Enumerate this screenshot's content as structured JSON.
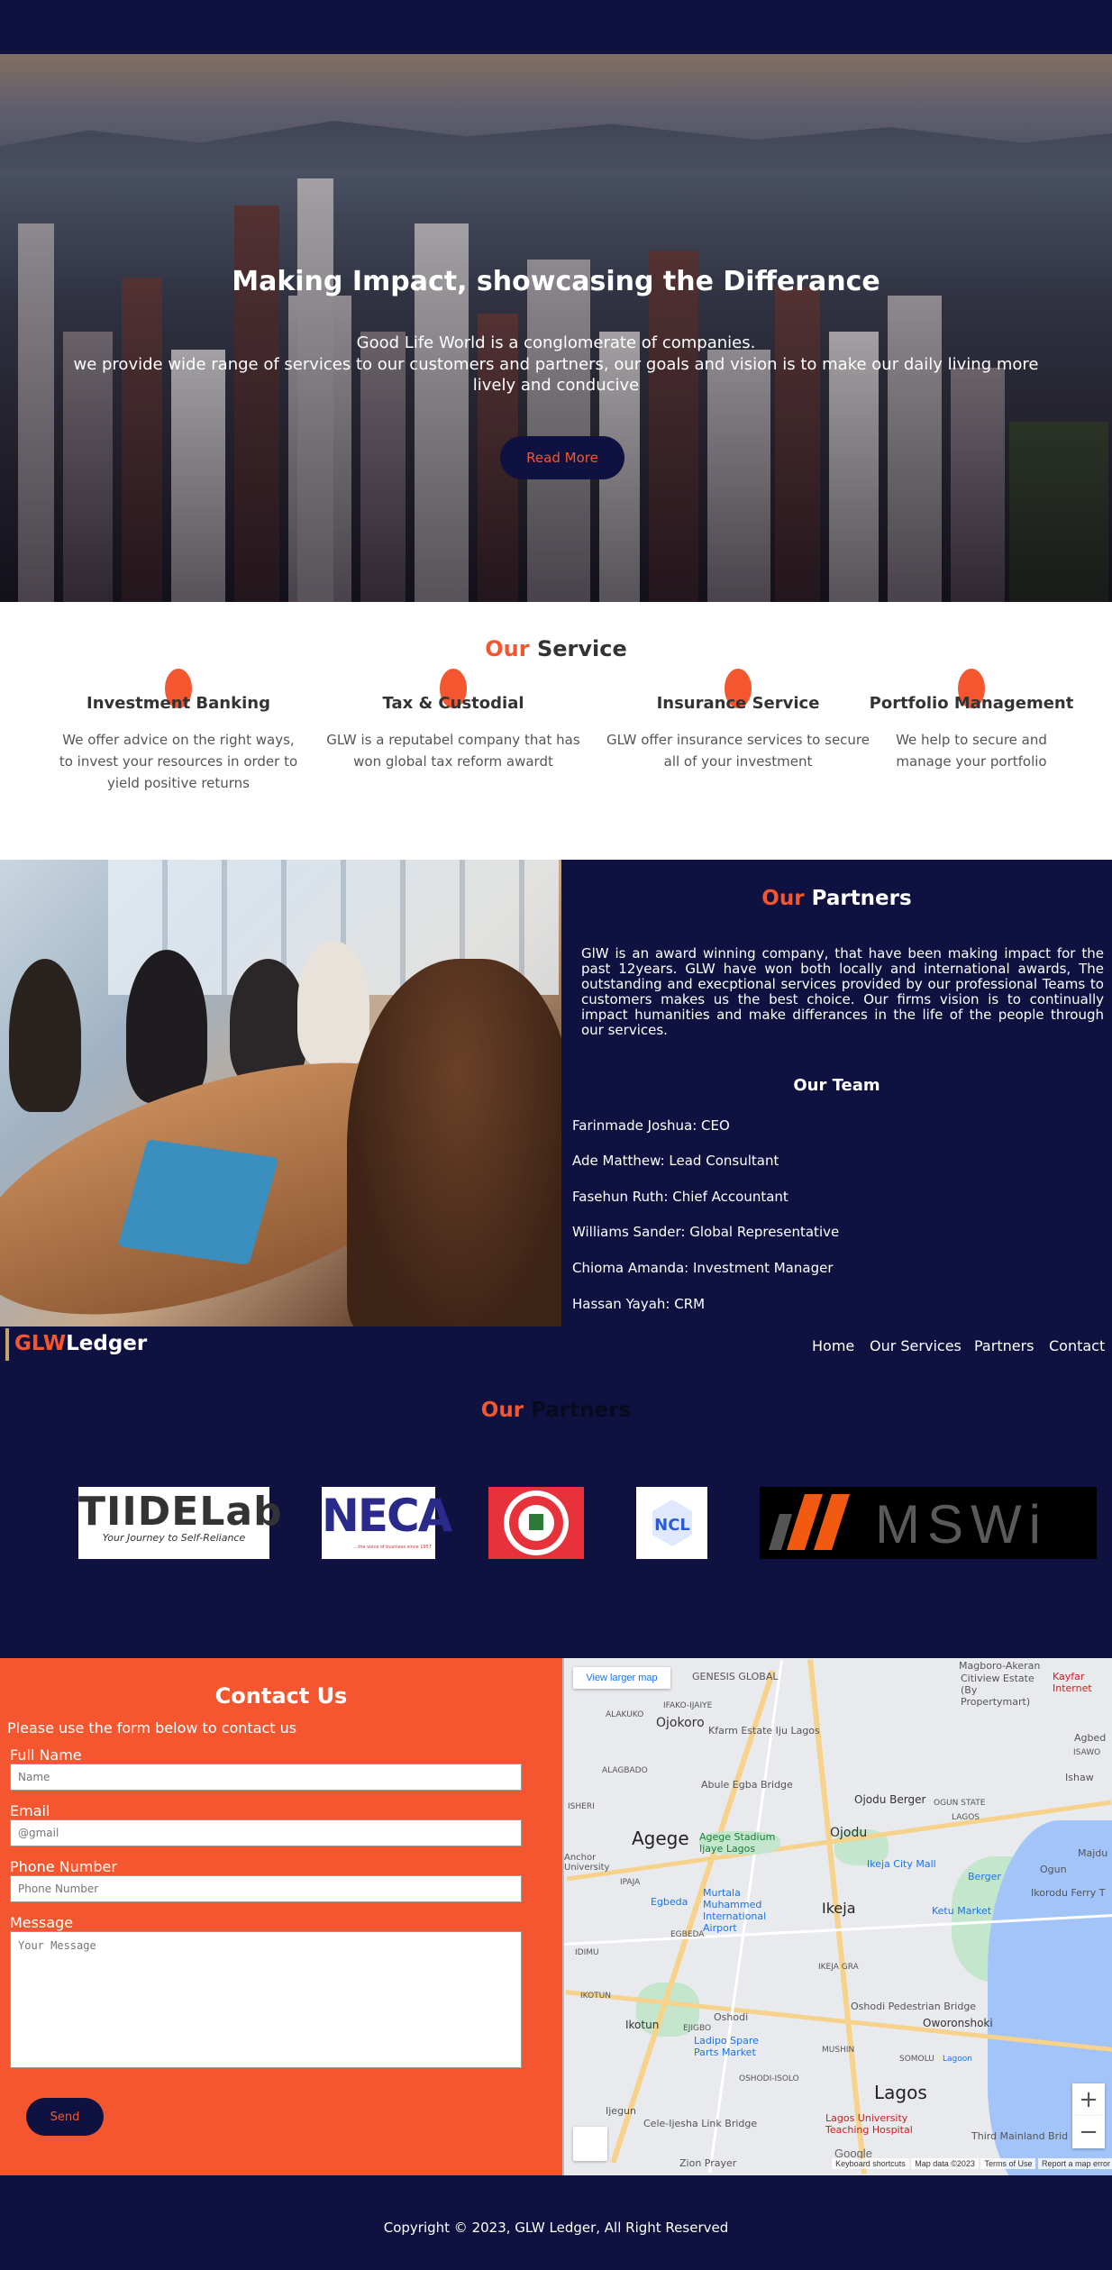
{
  "hero": {
    "title": "Making Impact, showcasing the Differance",
    "line1": "Good Life World is a conglomerate of companies.",
    "line2": "we provide wide range of services to our customers and partners, our goals and vision is to make our daily living more lively and conducive",
    "button": "Read More"
  },
  "services": {
    "title_accent": "Our",
    "title_rest": " Service",
    "items": [
      {
        "title": "Investment Banking",
        "text": "We offer advice on the right ways, to invest your resources in order to yield positive returns"
      },
      {
        "title": "Tax & Custodial",
        "text": "GLW is a reputabel company that has won global tax reform awardt"
      },
      {
        "title": "Insurance Service",
        "text": "GLW offer insurance services to secure all of your investment"
      },
      {
        "title": "Portfolio Management",
        "text": "We help to secure and manage your portfolio"
      }
    ]
  },
  "about": {
    "title_accent": "Our",
    "title_rest": " Partners",
    "text": "GlW is an award winning company, that have been making impact for the past 12years. GLW have won both locally and international awards, The outstanding and execptional services provided by our professional Teams to customers makes us the best choice. Our firms vision is to continually impact humanities and make differances in the life of the people through our services.",
    "team_title": "Our Team",
    "team": [
      "Farinmade Joshua: CEO",
      "Ade Matthew: Lead Consultant",
      "Fasehun Ruth: Chief Accountant",
      "Williams Sander: Global Representative",
      "Chioma Amanda: Investment Manager",
      "Hassan Yayah: CRM"
    ]
  },
  "nav": {
    "logo_accent": "GLW",
    "logo_rest": "Ledger",
    "links": [
      "Home",
      "Our Services",
      "Partners",
      "Contact"
    ]
  },
  "partners": {
    "title_accent": "Our",
    "title_rest": " Partners",
    "logos": [
      {
        "name": "TIIDELab",
        "tagline": "Your Journey to Self-Reliance"
      },
      {
        "name": "NECA",
        "tagline": "...the voice of business since 1957"
      },
      {
        "name": "Industrial Training Fund"
      },
      {
        "name": "NCL"
      },
      {
        "name": "MSWi"
      }
    ]
  },
  "contact": {
    "title": "Contact Us",
    "intro": "Please use the form below to contact us",
    "fields": [
      {
        "label": "Full Name",
        "placeholder": "Name"
      },
      {
        "label": "Email",
        "placeholder": "@gmail"
      },
      {
        "label": "Phone Number",
        "placeholder": "Phone Number"
      },
      {
        "label": "Message",
        "placeholder": "Your Message"
      }
    ],
    "send": "Send"
  },
  "map": {
    "view_larger": "View larger map",
    "labels": {
      "genesis": "GENESIS GLOBAL",
      "magboro": "Magboro-Akeran",
      "citiview": "Citiview Estate (By Propertymart)",
      "kayfar": "Kayfar Internet",
      "alakuko": "ALAKUKO",
      "ojokoro": "Ojokoro",
      "ifako": "IFAKO-IJAIYE",
      "kfarm": "Kfarm Estate Iju Lagos",
      "agbede": "Agbed",
      "isawo": "ISAWO",
      "alagbado": "ALAGBADO",
      "abule": "Abule Egba Bridge",
      "ojodu_berger": "Ojodu Berger",
      "ogun": "OGUN STATE",
      "lagos_state": "LAGOS",
      "ishawo": "Ishaw",
      "agege": "Agege",
      "stadium": "Agege Stadium Ijaye Lagos",
      "ojodu": "Ojodu",
      "ikeja_city": "Ikeja City Mall",
      "berger": "Berger",
      "ogun2": "Ogun",
      "majidun": "Majdu",
      "anchor": "Anchor University",
      "ipaja": "IPAJA",
      "ikorodu": "Ikorodu Ferry T",
      "egbeda": "Egbeda",
      "murtala": "Murtala Muhammed International Airport",
      "ikeja": "Ikeja",
      "ketu": "Ketu Market",
      "egbeda2": "EGBEDA",
      "idimu": "IDIMU",
      "ikeja_gra": "IKEJA GRA",
      "oshodi_bridge": "Oshodi Pedestrian Bridge",
      "ikotun": "IKOTUN",
      "oworonshoki": "Oworonshoki",
      "ikotun2": "Ikotun",
      "oshodi": "Oshodi",
      "ejigbo": "EJIGBO",
      "mushin": "MUSHIN",
      "lagos": "Lagos",
      "somolu": "SOMOLU",
      "lagoon": "Lagoon",
      "ladipo": "Ladipo Spare Parts Market",
      "oshodi_isolo": "OSHODI-ISOLO",
      "ijegun": "Ijegun",
      "cele": "Cele-Ijesha Link Bridge",
      "luth": "Lagos University Teaching Hospital",
      "third": "Third Mainland Brid",
      "zion": "Zion Prayer",
      "isheri": "ISHERI"
    },
    "footer": [
      "Keyboard shortcuts",
      "Map data ©2023",
      "Terms of Use",
      "Report a map error"
    ],
    "google": "Google"
  },
  "footer": {
    "copyright": "Copyright © 2023, GLW Ledger, All Right Reserved"
  },
  "colors": {
    "navy": "#0f1140",
    "accent": "#f4562f"
  }
}
